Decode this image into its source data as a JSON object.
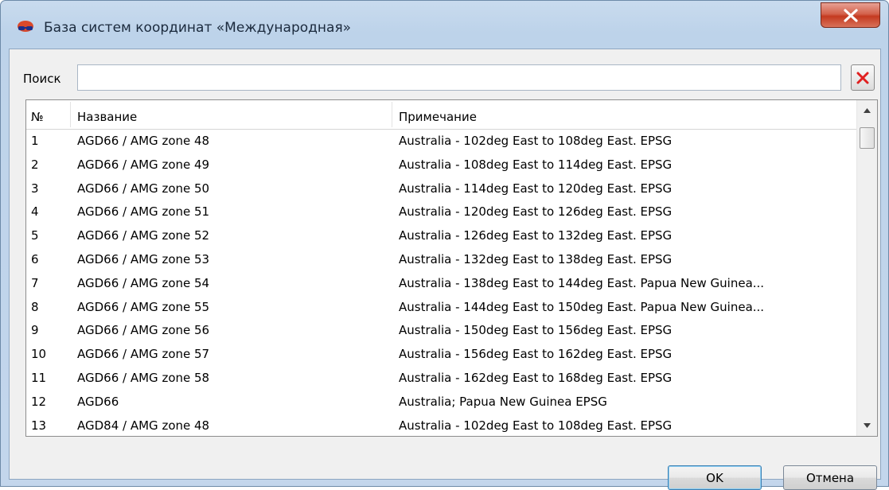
{
  "window": {
    "title": "База систем координат «Международная»",
    "close_symbol": "×"
  },
  "search": {
    "label": "Поиск",
    "value": "",
    "placeholder": ""
  },
  "table": {
    "columns": [
      "№",
      "Название",
      "Примечание"
    ],
    "rows": [
      {
        "num": "1",
        "name": "AGD66 / AMG zone 48",
        "note": "Australia - 102deg East to 108deg East. EPSG"
      },
      {
        "num": "2",
        "name": "AGD66 / AMG zone 49",
        "note": "Australia - 108deg East to 114deg East. EPSG"
      },
      {
        "num": "3",
        "name": "AGD66 / AMG zone 50",
        "note": "Australia - 114deg East to 120deg East. EPSG"
      },
      {
        "num": "4",
        "name": "AGD66 / AMG zone 51",
        "note": "Australia - 120deg East to 126deg East. EPSG"
      },
      {
        "num": "5",
        "name": "AGD66 / AMG zone 52",
        "note": "Australia - 126deg East to 132deg East. EPSG"
      },
      {
        "num": "6",
        "name": "AGD66 / AMG zone 53",
        "note": "Australia - 132deg East to 138deg East. EPSG"
      },
      {
        "num": "7",
        "name": "AGD66 / AMG zone 54",
        "note": "Australia - 138deg East to 144deg East.  Papua New Guinea..."
      },
      {
        "num": "8",
        "name": "AGD66 / AMG zone 55",
        "note": "Australia - 144deg East to 150deg East.  Papua New Guinea..."
      },
      {
        "num": "9",
        "name": "AGD66 / AMG zone 56",
        "note": "Australia - 150deg East to 156deg East. EPSG"
      },
      {
        "num": "10",
        "name": "AGD66 / AMG zone 57",
        "note": "Australia - 156deg East to 162deg East. EPSG"
      },
      {
        "num": "11",
        "name": "AGD66 / AMG zone 58",
        "note": "Australia - 162deg East to 168deg East. EPSG"
      },
      {
        "num": "12",
        "name": "AGD66",
        "note": "Australia; Papua New Guinea EPSG"
      },
      {
        "num": "13",
        "name": "AGD84 / AMG zone 48",
        "note": "Australia - 102deg East to 108deg East. EPSG"
      }
    ]
  },
  "buttons": {
    "ok": "OK",
    "cancel": "Отмена"
  },
  "icons": {
    "app": "glasses-icon",
    "clear": "red-x-icon",
    "scroll_up": "arrow-up-icon",
    "scroll_down": "arrow-down-icon"
  },
  "colors": {
    "clear_x": "#e02020",
    "close_button": "#c43a20"
  }
}
